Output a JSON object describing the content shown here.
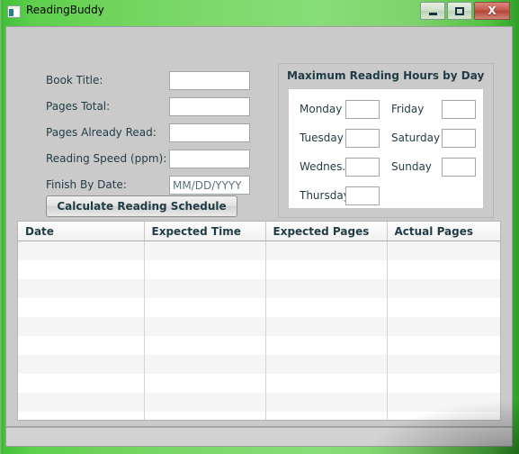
{
  "window": {
    "title": "ReadingBuddy",
    "icon": "app-window-icon",
    "controls": {
      "minimize_label": "–",
      "maximize_label": "□",
      "close_label": "X"
    }
  },
  "form": {
    "fields": [
      {
        "label": "Book Title:",
        "value": "",
        "placeholder": ""
      },
      {
        "label": "Pages Total:",
        "value": "",
        "placeholder": ""
      },
      {
        "label": "Pages Already Read:",
        "value": "",
        "placeholder": ""
      },
      {
        "label": "Reading Speed (ppm):",
        "value": "",
        "placeholder": ""
      },
      {
        "label": "Finish By Date:",
        "value": "",
        "placeholder": "MM/DD/YYYY"
      }
    ],
    "calculate_button": "Calculate Reading Schedule"
  },
  "hours_group": {
    "title": "Maximum Reading Hours by Day",
    "left_column": [
      {
        "label": "Monday",
        "value": ""
      },
      {
        "label": "Tuesday",
        "value": ""
      },
      {
        "label": "Wednes.",
        "value": ""
      },
      {
        "label": "Thursday",
        "value": ""
      }
    ],
    "right_column": [
      {
        "label": "Friday",
        "value": ""
      },
      {
        "label": "Saturday",
        "value": ""
      },
      {
        "label": "Sunday",
        "value": ""
      }
    ]
  },
  "schedule_table": {
    "columns": [
      "Date",
      "Expected Time",
      "Expected Pages",
      "Actual Pages"
    ],
    "rows": [
      [
        "",
        "",
        "",
        ""
      ],
      [
        "",
        "",
        "",
        ""
      ],
      [
        "",
        "",
        "",
        ""
      ],
      [
        "",
        "",
        "",
        ""
      ],
      [
        "",
        "",
        "",
        ""
      ],
      [
        "",
        "",
        "",
        ""
      ],
      [
        "",
        "",
        "",
        ""
      ],
      [
        "",
        "",
        "",
        ""
      ],
      [
        "",
        "",
        "",
        ""
      ],
      [
        "",
        "",
        "",
        ""
      ]
    ]
  },
  "statusbar": {
    "text": ""
  },
  "colors": {
    "titlebar_green": "#6ed45a",
    "close_red": "#c75a4c",
    "text_dark": "#1f3b46",
    "client_gray": "#cacaca"
  }
}
